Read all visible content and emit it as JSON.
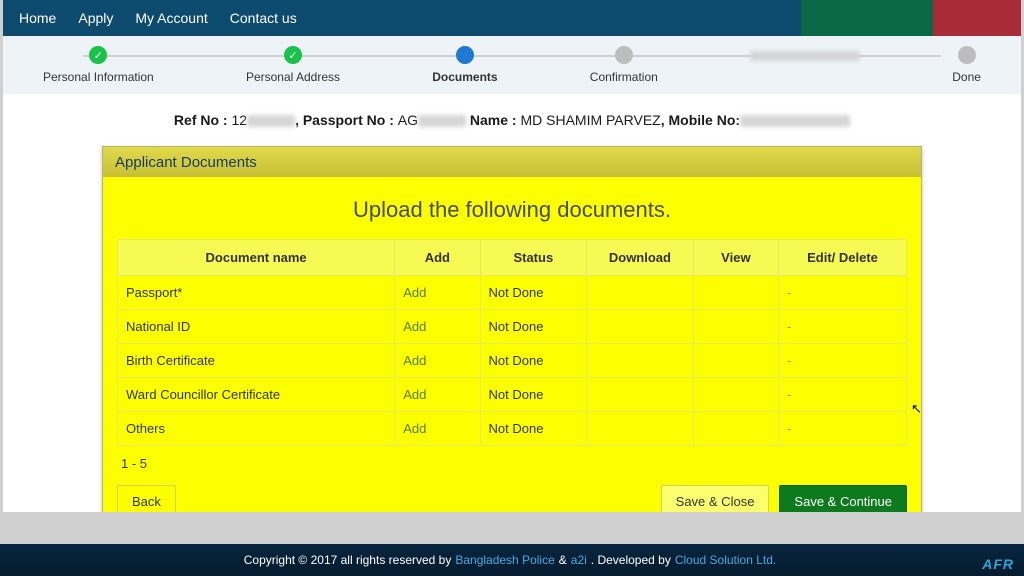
{
  "nav": {
    "home": "Home",
    "apply": "Apply",
    "account": "My Account",
    "contact": "Contact us"
  },
  "steps": {
    "s1": "Personal Information",
    "s2": "Personal Address",
    "s3": "Documents",
    "s4": "Confirmation",
    "s6": "Done"
  },
  "refline": {
    "ref_lbl": "Ref No : ",
    "ref_val": "12",
    "passport_lbl": ", Passport No : ",
    "passport_val": "AG",
    "name_lbl": " Name : ",
    "name_val": "MD SHAMIM PARVEZ",
    "mobile_lbl": ", Mobile No:"
  },
  "panel": {
    "title": "Applicant Documents",
    "upload_title": "Upload the following documents."
  },
  "table": {
    "headers": {
      "name": "Document name",
      "add": "Add",
      "status": "Status",
      "download": "Download",
      "view": "View",
      "edit": "Edit/ Delete"
    },
    "rows": [
      {
        "name": "Passport*",
        "add": "Add",
        "status": "Not Done",
        "edit": "-"
      },
      {
        "name": "National ID",
        "add": "Add",
        "status": "Not Done",
        "edit": "-"
      },
      {
        "name": "Birth Certificate",
        "add": "Add",
        "status": "Not Done",
        "edit": "-"
      },
      {
        "name": "Ward Councillor Certificate",
        "add": "Add",
        "status": "Not Done",
        "edit": "-"
      },
      {
        "name": "Others",
        "add": "Add",
        "status": "Not Done",
        "edit": "-"
      }
    ],
    "rowcount": "1 - 5"
  },
  "buttons": {
    "back": "Back",
    "save_close": "Save & Close",
    "save_continue": "Save & Continue"
  },
  "footer": {
    "copy": "Copyright © 2017 all rights reserved by ",
    "link1": "Bangladesh Police",
    "amp": " & ",
    "link2": "a2i",
    "dev": ". Developed by ",
    "link3": "Cloud Solution Ltd.",
    "logo": "AFR"
  }
}
